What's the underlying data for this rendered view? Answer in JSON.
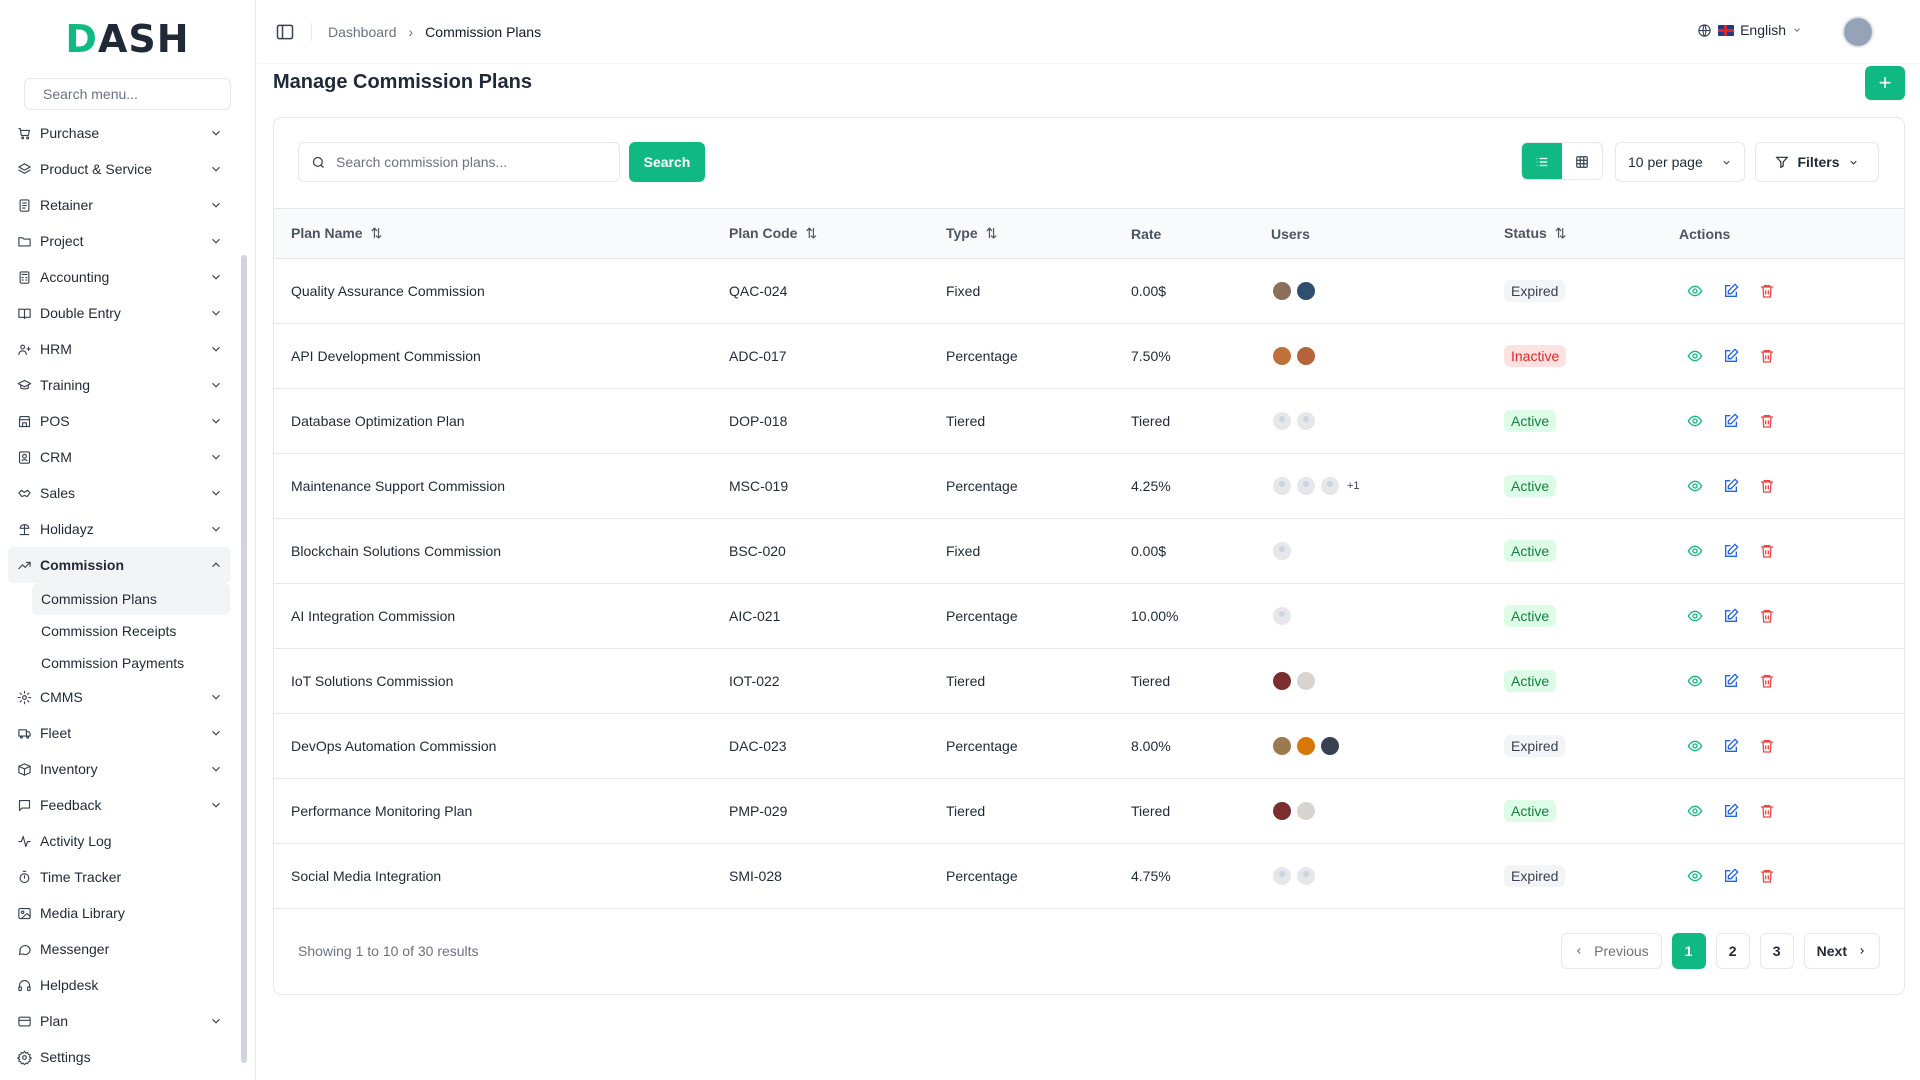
{
  "brand": {
    "logo_text": "DASH",
    "accent": "#10b981"
  },
  "sidebar": {
    "search_placeholder": "Search menu...",
    "items": [
      {
        "label": "Purchase",
        "icon": "cart-icon",
        "chevron": true
      },
      {
        "label": "Product & Service",
        "icon": "layers-icon",
        "chevron": true
      },
      {
        "label": "Retainer",
        "icon": "doc-icon",
        "chevron": true
      },
      {
        "label": "Project",
        "icon": "folder-icon",
        "chevron": true
      },
      {
        "label": "Accounting",
        "icon": "calculator-icon",
        "chevron": true
      },
      {
        "label": "Double Entry",
        "icon": "book-icon",
        "chevron": true
      },
      {
        "label": "HRM",
        "icon": "users-icon",
        "chevron": true
      },
      {
        "label": "Training",
        "icon": "graduation-icon",
        "chevron": true
      },
      {
        "label": "POS",
        "icon": "store-icon",
        "chevron": true
      },
      {
        "label": "CRM",
        "icon": "contact-icon",
        "chevron": true
      },
      {
        "label": "Sales",
        "icon": "handshake-icon",
        "chevron": true
      },
      {
        "label": "Holidayz",
        "icon": "holiday-icon",
        "chevron": true
      },
      {
        "label": "Commission",
        "icon": "trend-icon",
        "chevron": true,
        "active": true
      }
    ],
    "commission_sub": [
      {
        "label": "Commission Plans",
        "active": true
      },
      {
        "label": "Commission Receipts"
      },
      {
        "label": "Commission Payments"
      }
    ],
    "items_after": [
      {
        "label": "CMMS",
        "icon": "gear-icon",
        "chevron": true
      },
      {
        "label": "Fleet",
        "icon": "truck-icon",
        "chevron": true
      },
      {
        "label": "Inventory",
        "icon": "box-icon",
        "chevron": true
      },
      {
        "label": "Feedback",
        "icon": "message-icon",
        "chevron": true
      },
      {
        "label": "Activity Log",
        "icon": "activity-icon",
        "chevron": false
      },
      {
        "label": "Time Tracker",
        "icon": "timer-icon",
        "chevron": false
      },
      {
        "label": "Media Library",
        "icon": "image-icon",
        "chevron": false
      },
      {
        "label": "Messenger",
        "icon": "chat-icon",
        "chevron": false
      },
      {
        "label": "Helpdesk",
        "icon": "headset-icon",
        "chevron": false
      },
      {
        "label": "Plan",
        "icon": "card-icon",
        "chevron": true
      },
      {
        "label": "Settings",
        "icon": "settings-icon",
        "chevron": false
      }
    ]
  },
  "header": {
    "breadcrumb": [
      "Dashboard",
      "Commission Plans"
    ],
    "language": "English"
  },
  "page": {
    "title": "Manage Commission Plans",
    "add_label": "+",
    "search_placeholder": "Search commission plans...",
    "search_button": "Search",
    "per_page": "10 per page",
    "filters_label": "Filters"
  },
  "table": {
    "columns": [
      "Plan Name",
      "Plan Code",
      "Type",
      "Rate",
      "Users",
      "Status",
      "Actions"
    ],
    "rows": [
      {
        "name": "Quality Assurance Commission",
        "code": "QAC-024",
        "type": "Fixed",
        "rate": "0.00$",
        "users": [
          "#8b6f5a",
          "#2f4f6f"
        ],
        "more": "",
        "status": "Expired"
      },
      {
        "name": "API Development Commission",
        "code": "ADC-017",
        "type": "Percentage",
        "rate": "7.50%",
        "users": [
          "#c0703a",
          "#b5643a"
        ],
        "more": "",
        "status": "Inactive"
      },
      {
        "name": "Database Optimization Plan",
        "code": "DOP-018",
        "type": "Tiered",
        "rate": "Tiered",
        "users": [
          "ph",
          "ph"
        ],
        "more": "",
        "status": "Active"
      },
      {
        "name": "Maintenance Support Commission",
        "code": "MSC-019",
        "type": "Percentage",
        "rate": "4.25%",
        "users": [
          "ph",
          "ph",
          "ph"
        ],
        "more": "+1",
        "status": "Active"
      },
      {
        "name": "Blockchain Solutions Commission",
        "code": "BSC-020",
        "type": "Fixed",
        "rate": "0.00$",
        "users": [
          "ph"
        ],
        "more": "",
        "status": "Active"
      },
      {
        "name": "AI Integration Commission",
        "code": "AIC-021",
        "type": "Percentage",
        "rate": "10.00%",
        "users": [
          "ph"
        ],
        "more": "",
        "status": "Active"
      },
      {
        "name": "IoT Solutions Commission",
        "code": "IOT-022",
        "type": "Tiered",
        "rate": "Tiered",
        "users": [
          "#7a2e2e",
          "#d9d4d0"
        ],
        "more": "",
        "status": "Active"
      },
      {
        "name": "DevOps Automation Commission",
        "code": "DAC-023",
        "type": "Percentage",
        "rate": "8.00%",
        "users": [
          "#9c7a50",
          "#d97706",
          "#374151"
        ],
        "more": "",
        "status": "Expired"
      },
      {
        "name": "Performance Monitoring Plan",
        "code": "PMP-029",
        "type": "Tiered",
        "rate": "Tiered",
        "users": [
          "#7a2e2e",
          "#d9d4d0"
        ],
        "more": "",
        "status": "Active"
      },
      {
        "name": "Social Media Integration",
        "code": "SMI-028",
        "type": "Percentage",
        "rate": "4.75%",
        "users": [
          "ph",
          "ph"
        ],
        "more": "",
        "status": "Expired"
      }
    ]
  },
  "pagination": {
    "showing": "Showing 1 to 10 of 30 results",
    "previous": "Previous",
    "next": "Next",
    "pages": [
      "1",
      "2",
      "3"
    ],
    "current": "1"
  }
}
